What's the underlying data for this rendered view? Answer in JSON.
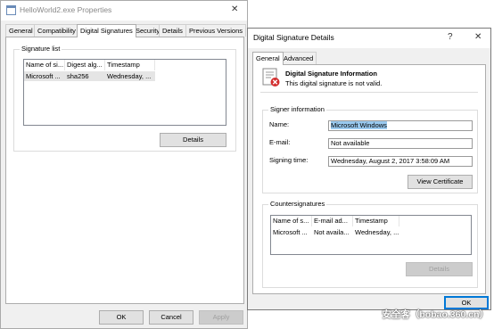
{
  "props": {
    "title": "HelloWorld2.exe Properties",
    "close_glyph": "✕",
    "tabs": [
      "General",
      "Compatibility",
      "Digital Signatures",
      "Security",
      "Details",
      "Previous Versions"
    ],
    "sig_list_label": "Signature list",
    "columns": [
      "Name of si...",
      "Digest alg...",
      "Timestamp"
    ],
    "row": [
      "Microsoft ...",
      "sha256",
      "Wednesday, ..."
    ],
    "details_btn": "Details",
    "ok": "OK",
    "cancel": "Cancel",
    "apply": "Apply"
  },
  "details": {
    "title": "Digital Signature Details",
    "help_glyph": "?",
    "close_glyph": "✕",
    "tabs": [
      "General",
      "Advanced"
    ],
    "info_heading": "Digital Signature Information",
    "info_status": "This digital signature is not valid.",
    "signer_label": "Signer information",
    "name_label": "Name:",
    "name_value": "Microsoft Windows",
    "email_label": "E-mail:",
    "email_value": "Not available",
    "time_label": "Signing time:",
    "time_value": "Wednesday, August 2, 2017 3:58:09 AM",
    "view_cert": "View Certificate",
    "counter_label": "Countersignatures",
    "cs_columns": [
      "Name of s...",
      "E-mail ad...",
      "Timestamp"
    ],
    "cs_row": [
      "Microsoft ...",
      "Not availa...",
      "Wednesday, ..."
    ],
    "cs_details": "Details",
    "ok": "OK"
  },
  "watermark": "安全客（bobao.360.cn）",
  "colors": {
    "selection": "#99c9ef",
    "default_button_border": "#0078d7",
    "error_badge": "#d32f2f"
  }
}
